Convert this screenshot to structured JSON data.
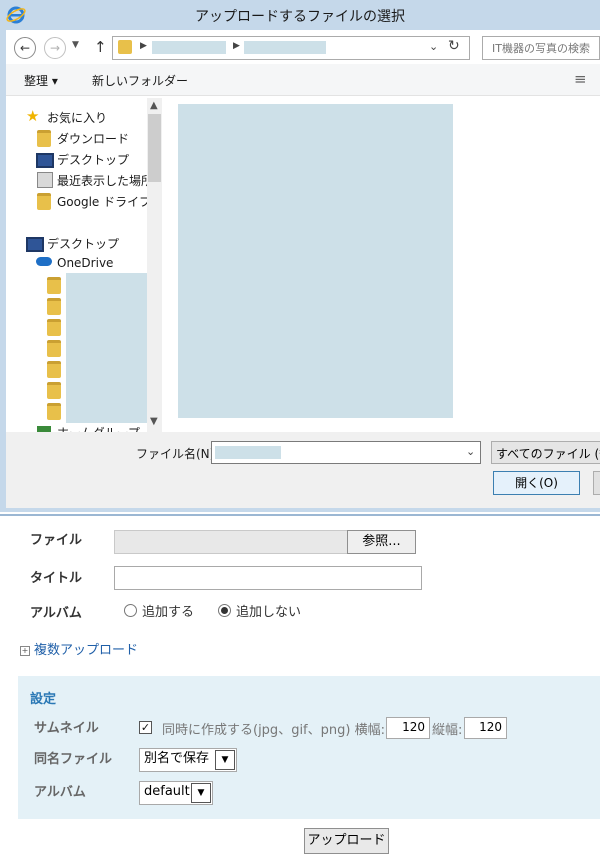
{
  "dialog": {
    "title": "アップロードするファイルの選択",
    "address": {
      "search_placeholder": "IT機器の写真の検索"
    },
    "toolbar": {
      "organize_label": "整理 ▾",
      "new_folder_label": "新しいフォルダー"
    },
    "nav": {
      "favorites": "お気に入り",
      "downloads": "ダウンロード",
      "desktop": "デスクトップ",
      "recent": "最近表示した場所",
      "google_drive": "Google ドライブ",
      "desktop2": "デスクトップ",
      "onedrive": "OneDrive",
      "homegroup": "ホームグループ"
    },
    "filename_label": "ファイル名(N):",
    "filetype_label": "すべてのファイル (*.*)",
    "open_label": "開く(O)"
  },
  "form": {
    "file_label": "ファイル",
    "browse_label": "参照...",
    "title_label": "タイトル",
    "album_label": "アルバム",
    "album_add": "追加する",
    "album_noadd": "追加しない",
    "multi_upload": "複数アップロード",
    "settings": {
      "title": "設定",
      "thumbnail_label": "サムネイル",
      "thumbnail_text": "同時に作成する(jpg、gif、png) 横幅:",
      "width_value": "120",
      "height_label": "縦幅:",
      "height_value": "120",
      "samename_label": "同名ファイル",
      "samename_value": "別名で保存",
      "album_label": "アルバム",
      "album_value": "default"
    },
    "upload_label": "アップロード"
  }
}
